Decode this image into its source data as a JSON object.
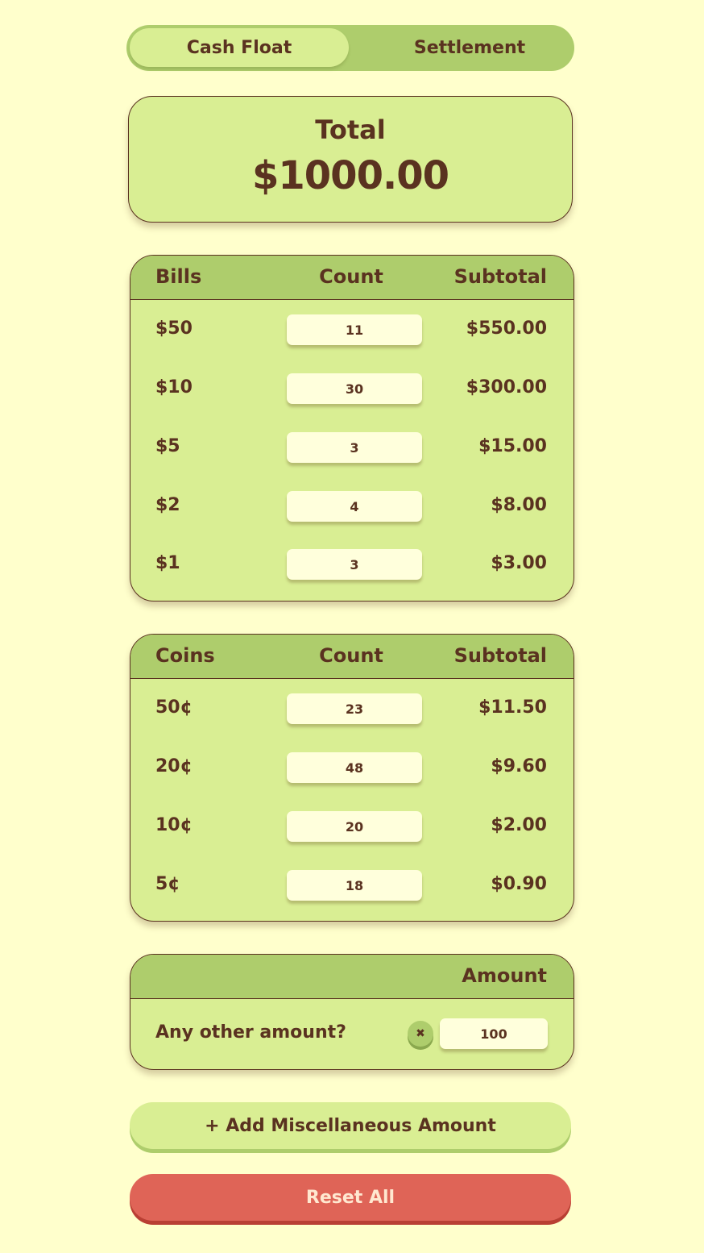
{
  "tabs": [
    {
      "label": "Cash Float",
      "active": true
    },
    {
      "label": "Settlement",
      "active": false
    }
  ],
  "total": {
    "label": "Total",
    "value": "$1000.00"
  },
  "bills": {
    "headers": {
      "label": "Bills",
      "count": "Count",
      "subtotal": "Subtotal"
    },
    "rows": [
      {
        "label": "$50",
        "count": "11",
        "subtotal": "$550.00"
      },
      {
        "label": "$10",
        "count": "30",
        "subtotal": "$300.00"
      },
      {
        "label": "$5",
        "count": "3",
        "subtotal": "$15.00"
      },
      {
        "label": "$2",
        "count": "4",
        "subtotal": "$8.00"
      },
      {
        "label": "$1",
        "count": "3",
        "subtotal": "$3.00"
      }
    ]
  },
  "coins": {
    "headers": {
      "label": "Coins",
      "count": "Count",
      "subtotal": "Subtotal"
    },
    "rows": [
      {
        "label": "50¢",
        "count": "23",
        "subtotal": "$11.50"
      },
      {
        "label": "20¢",
        "count": "48",
        "subtotal": "$9.60"
      },
      {
        "label": "10¢",
        "count": "20",
        "subtotal": "$2.00"
      },
      {
        "label": "5¢",
        "count": "18",
        "subtotal": "$0.90"
      }
    ]
  },
  "misc": {
    "header": "Amount",
    "label": "Any other amount?",
    "value": "100",
    "clear_icon": "close-icon",
    "clear_glyph": "✖"
  },
  "buttons": {
    "add": "+ Add Miscellaneous Amount",
    "reset": "Reset All"
  },
  "colors": {
    "background": "#ffffcc",
    "panel": "#d9ee93",
    "header": "#aecd6c",
    "text": "#5a3220",
    "danger": "#df6457"
  }
}
